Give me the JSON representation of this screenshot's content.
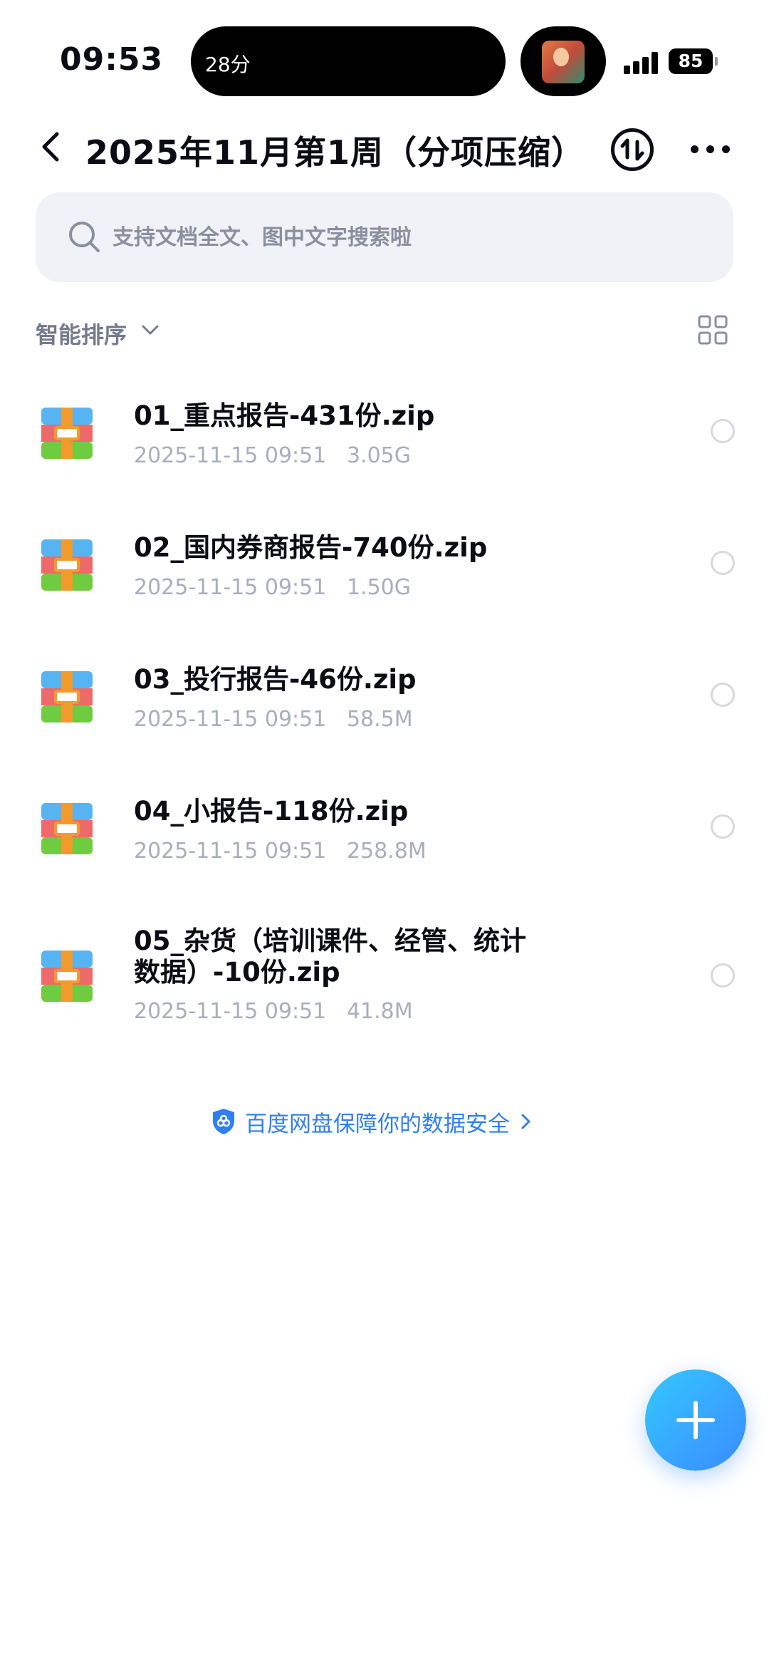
{
  "status_bar": {
    "time": "09:53",
    "island_text": "28分",
    "battery": "85"
  },
  "header": {
    "title": "2025年11月第1周（分项压缩）"
  },
  "search": {
    "placeholder": "支持文档全文、图中文字搜索啦"
  },
  "sort": {
    "label": "智能排序"
  },
  "files": [
    {
      "name": "01_重点报告-431份.zip",
      "date": "2025-11-15 09:51",
      "size": "3.05G"
    },
    {
      "name": "02_国内券商报告-740份.zip",
      "date": "2025-11-15 09:51",
      "size": "1.50G"
    },
    {
      "name": "03_投行报告-46份.zip",
      "date": "2025-11-15 09:51",
      "size": "58.5M"
    },
    {
      "name": "04_小报告-118份.zip",
      "date": "2025-11-15 09:51",
      "size": "258.8M"
    },
    {
      "name": "05_杂货（培训课件、经管、统计数据）-10份.zip",
      "date": "2025-11-15 09:51",
      "size": "41.8M"
    }
  ],
  "footer": {
    "safety_text": "百度网盘保障你的数据安全"
  },
  "colors": {
    "accent": "#2f7ff0",
    "fab_start": "#35c8ff",
    "fab_end": "#3a8bff",
    "meta_text": "#a9aebb"
  },
  "icons": {
    "back": "chevron-left-icon",
    "transfer": "transfer-icon",
    "more": "more-icon",
    "search": "search-icon",
    "grid": "grid-view-icon",
    "file": "zip-archive-icon",
    "shield": "shield-icon",
    "add": "plus-icon"
  }
}
